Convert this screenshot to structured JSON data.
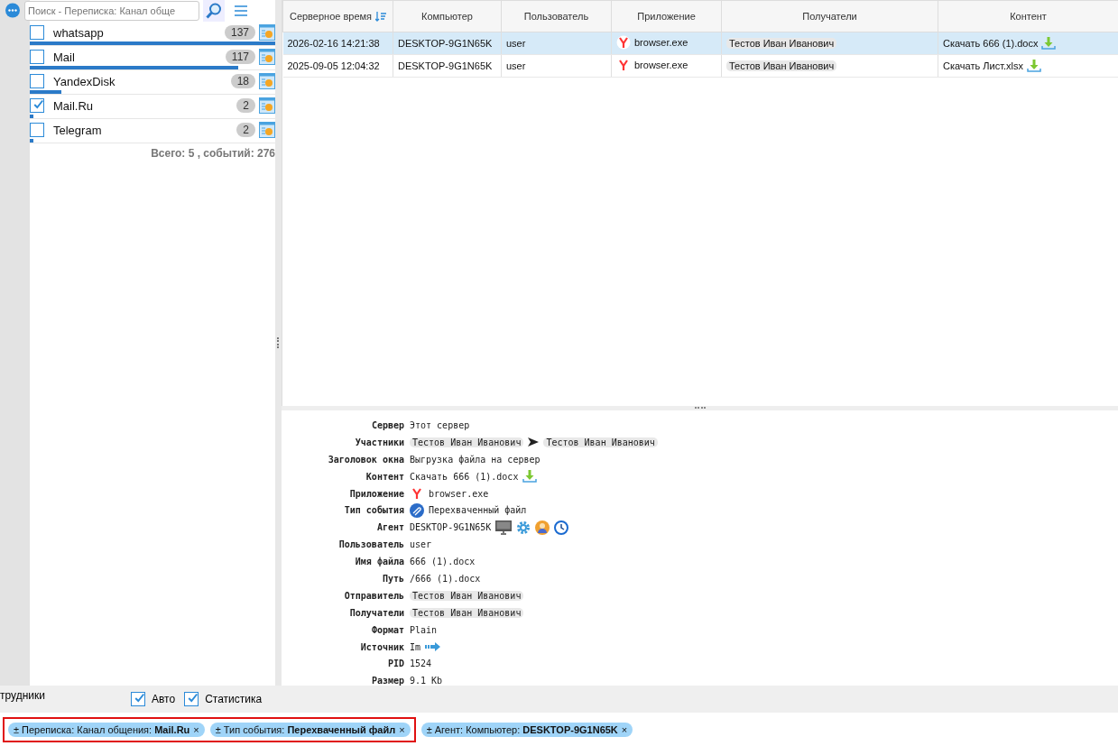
{
  "sidebar": {
    "search": {
      "placeholder": "Поиск - Переписка: Канал обще"
    },
    "channels": [
      {
        "name": "whatsapp",
        "count": "137",
        "checked": false,
        "level": 1
      },
      {
        "name": "Mail",
        "count": "117",
        "checked": false,
        "level": 0.85
      },
      {
        "name": "YandexDisk",
        "count": "18",
        "checked": false,
        "level": 0.13
      },
      {
        "name": "Mail.Ru",
        "count": "2",
        "checked": true,
        "level": 0.015
      },
      {
        "name": "Telegram",
        "count": "2",
        "checked": false,
        "level": 0.015
      }
    ],
    "total": "Всего: 5 , событий: 276"
  },
  "table": {
    "columns": [
      "Серверное время",
      "Компьютер",
      "Пользователь",
      "Приложение",
      "Получатели",
      "Контент"
    ],
    "rows": [
      {
        "selected": true,
        "time": "2026-02-16 14:21:38",
        "computer": "DESKTOP-9G1N65K",
        "user": "user",
        "app": "browser.exe",
        "recipients": "Тестов Иван Иванович",
        "content": "Скачать 666 (1).docx"
      },
      {
        "selected": false,
        "time": "2025-09-05 12:04:32",
        "computer": "DESKTOP-9G1N65K",
        "user": "user",
        "app": "browser.exe",
        "recipients": "Тестов Иван Иванович",
        "content": "Скачать Лист.xlsx"
      }
    ]
  },
  "details": [
    {
      "kind": "text",
      "label": "Сервер",
      "value": "Этот сервер"
    },
    {
      "kind": "participants",
      "label": "Участники",
      "from": "Тестов Иван Иванович",
      "to": "Тестов Иван Иванович"
    },
    {
      "kind": "text",
      "label": "Заголовок окна",
      "value": "Выгрузка файла на сервер"
    },
    {
      "kind": "content",
      "label": "Контент",
      "value": "Скачать 666 (1).docx"
    },
    {
      "kind": "app",
      "label": "Приложение",
      "value": "browser.exe"
    },
    {
      "kind": "event",
      "label": "Тип события",
      "value": "Перехваченный файл"
    },
    {
      "kind": "agent",
      "label": "Агент",
      "value": "DESKTOP-9G1N65K"
    },
    {
      "kind": "text",
      "label": "Пользователь",
      "value": "user"
    },
    {
      "kind": "text",
      "label": "Имя файла",
      "value": "666 (1).docx"
    },
    {
      "kind": "text",
      "label": "Путь",
      "value": "/666 (1).docx"
    },
    {
      "kind": "chip",
      "label": "Отправитель",
      "value": "Тестов Иван Иванович"
    },
    {
      "kind": "chip",
      "label": "Получатели",
      "value": "Тестов Иван Иванович"
    },
    {
      "kind": "text",
      "label": "Формат",
      "value": "Plain"
    },
    {
      "kind": "source",
      "label": "Источник",
      "value": "Im"
    },
    {
      "kind": "text",
      "label": "PID",
      "value": "1524"
    },
    {
      "kind": "text",
      "label": "Размер",
      "value": "9.1 Kb"
    }
  ],
  "options_bar": {
    "section": "трудники",
    "toggles": [
      {
        "label": "Авто",
        "checked": true
      },
      {
        "label": "Статистика",
        "checked": true
      }
    ]
  },
  "filters": [
    {
      "text": "± Переписка: Канал общения: **Mail.Ru**",
      "close": "×",
      "highlighted": true
    },
    {
      "text": "± Тип события: **Перехваченный файл**",
      "close": "×",
      "highlighted": true
    },
    {
      "text": "± Агент: Компьютер: **DESKTOP-9G1N65K**",
      "close": "×",
      "highlighted": false
    }
  ]
}
